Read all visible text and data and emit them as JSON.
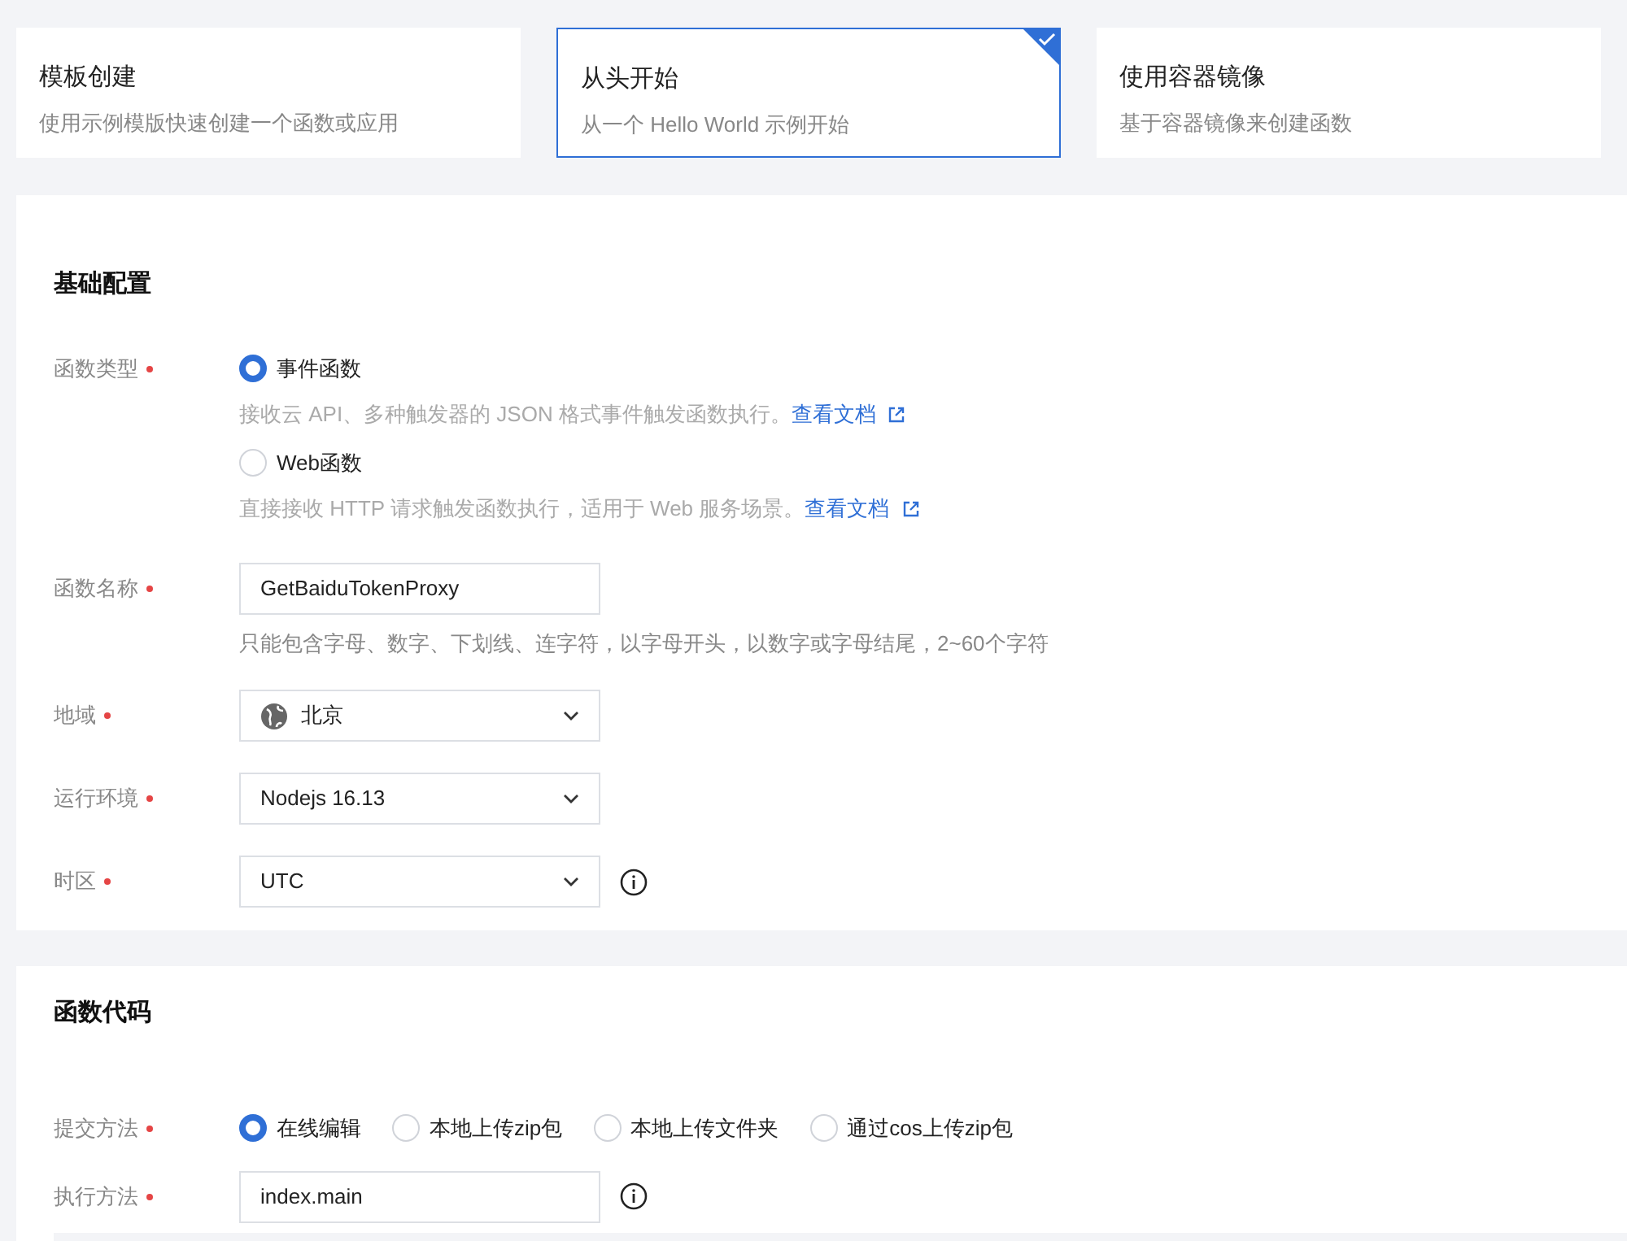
{
  "creation_options": [
    {
      "title": "模板创建",
      "description": "使用示例模版快速创建一个函数或应用",
      "selected": false
    },
    {
      "title": "从头开始",
      "description": "从一个 Hello World 示例开始",
      "selected": true
    },
    {
      "title": "使用容器镜像",
      "description": "基于容器镜像来创建函数",
      "selected": false
    }
  ],
  "basic_config": {
    "title": "基础配置",
    "fields": [
      {
        "kind": "radio_list",
        "label": "函数类型",
        "required": true,
        "options": [
          {
            "label": "事件函数",
            "selected": true,
            "description": "接收云 API、多种触发器的 JSON 格式事件触发函数执行。",
            "link": "查看文档"
          },
          {
            "label": "Web函数",
            "selected": false,
            "description": "直接接收 HTTP 请求触发函数执行，适用于 Web 服务场景。",
            "link": "查看文档"
          }
        ]
      },
      {
        "kind": "text",
        "label": "函数名称",
        "required": true,
        "value": "GetBaiduTokenProxy",
        "hint": "只能包含字母、数字、下划线、连字符，以字母开头，以数字或字母结尾，2~60个字符"
      },
      {
        "kind": "select",
        "label": "地域",
        "required": true,
        "value": "北京",
        "globe": true
      },
      {
        "kind": "select",
        "label": "运行环境",
        "required": true,
        "value": "Nodejs 16.13"
      },
      {
        "kind": "select",
        "label": "时区",
        "required": true,
        "value": "UTC",
        "info": true
      }
    ]
  },
  "function_code": {
    "title": "函数代码",
    "fields": [
      {
        "kind": "radio_row",
        "label": "提交方法",
        "required": true,
        "options": [
          {
            "label": "在线编辑",
            "selected": true
          },
          {
            "label": "本地上传zip包",
            "selected": false
          },
          {
            "label": "本地上传文件夹",
            "selected": false
          },
          {
            "label": "通过cos上传zip包",
            "selected": false
          }
        ]
      },
      {
        "kind": "text",
        "label": "执行方法",
        "required": true,
        "value": "index.main",
        "info": true
      }
    ]
  }
}
